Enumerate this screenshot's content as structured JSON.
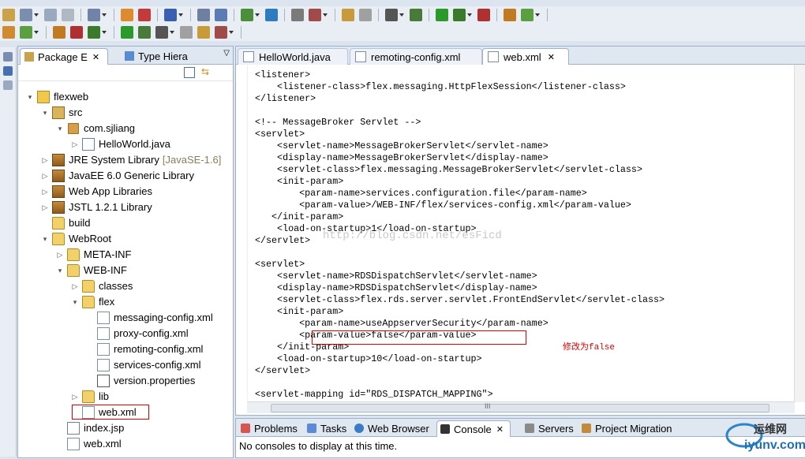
{
  "package_explorer": {
    "tabs": [
      {
        "label": "Package E",
        "close": "✕"
      },
      {
        "label": "Type Hiera"
      }
    ],
    "tree": [
      {
        "label": "flexweb",
        "icon": "project-icon",
        "arrow": "▾"
      },
      {
        "label": "src",
        "icon": "source-folder-icon",
        "arrow": "▾"
      },
      {
        "label": "com.sjliang",
        "icon": "package-icon",
        "arrow": "▾"
      },
      {
        "label": "HelloWorld.java",
        "icon": "java-file-icon",
        "arrow": "▷"
      },
      {
        "label": "JRE System Library",
        "suffix": "[JavaSE-1.6]",
        "icon": "library-icon",
        "arrow": "▷"
      },
      {
        "label": "JavaEE 6.0 Generic Library",
        "icon": "library-icon",
        "arrow": "▷"
      },
      {
        "label": "Web App Libraries",
        "icon": "library-icon",
        "arrow": "▷"
      },
      {
        "label": "JSTL 1.2.1 Library",
        "icon": "library-icon",
        "arrow": "▷"
      },
      {
        "label": "build",
        "icon": "folder-icon",
        "arrow": ""
      },
      {
        "label": "WebRoot",
        "icon": "folder-icon",
        "arrow": "▾"
      },
      {
        "label": "META-INF",
        "icon": "folder-icon",
        "arrow": "▷"
      },
      {
        "label": "WEB-INF",
        "icon": "folder-icon",
        "arrow": "▾"
      },
      {
        "label": "classes",
        "icon": "folder-icon",
        "arrow": "▷"
      },
      {
        "label": "flex",
        "icon": "folder-icon",
        "arrow": "▾"
      },
      {
        "label": "messaging-config.xml",
        "icon": "xml-file-icon",
        "arrow": ""
      },
      {
        "label": "proxy-config.xml",
        "icon": "xml-file-icon",
        "arrow": ""
      },
      {
        "label": "remoting-config.xml",
        "icon": "xml-file-icon",
        "arrow": ""
      },
      {
        "label": "services-config.xml",
        "icon": "xml-file-icon",
        "arrow": ""
      },
      {
        "label": "version.properties",
        "icon": "properties-file-icon",
        "arrow": ""
      },
      {
        "label": "lib",
        "icon": "folder-icon",
        "arrow": "▷"
      },
      {
        "label": "web.xml",
        "icon": "xml-file-icon",
        "arrow": ""
      },
      {
        "label": "index.jsp",
        "icon": "jsp-file-icon",
        "arrow": ""
      },
      {
        "label": "web.xml",
        "icon": "xml-file-icon",
        "arrow": ""
      }
    ]
  },
  "editor": {
    "tabs": [
      {
        "label": "HelloWorld.java"
      },
      {
        "label": "remoting-config.xml"
      },
      {
        "label": "web.xml",
        "close": "✕"
      }
    ],
    "code_lines": [
      "<listener>",
      "    <listener-class>flex.messaging.HttpFlexSession</listener-class>",
      "</listener>",
      "",
      "<!-- MessageBroker Servlet -->",
      "<servlet>",
      "    <servlet-name>MessageBrokerServlet</servlet-name>",
      "    <display-name>MessageBrokerServlet</display-name>",
      "    <servlet-class>flex.messaging.MessageBrokerServlet</servlet-class>",
      "    <init-param>",
      "        <param-name>services.configuration.file</param-name>",
      "        <param-value>/WEB-INF/flex/services-config.xml</param-value>",
      "   </init-param>",
      "    <load-on-startup>1</load-on-startup>",
      "</servlet>",
      "",
      "<servlet>",
      "    <servlet-name>RDSDispatchServlet</servlet-name>",
      "    <display-name>RDSDispatchServlet</display-name>",
      "    <servlet-class>flex.rds.server.servlet.FrontEndServlet</servlet-class>",
      "    <init-param>",
      "        <param-name>useAppserverSecurity</param-name>",
      "        <param-value>false</param-value>",
      "    </init-param>",
      "    <load-on-startup>10</load-on-startup>",
      "</servlet>",
      "",
      "<servlet-mapping id=\"RDS_DISPATCH_MAPPING\">"
    ],
    "annotation": "修改为false",
    "watermark": "http://blog.csdn.net/esFicd",
    "scroll_marker": "III"
  },
  "console": {
    "tabs": [
      {
        "label": "Problems"
      },
      {
        "label": "Tasks"
      },
      {
        "label": "Web Browser"
      },
      {
        "label": "Console",
        "close": "✕"
      },
      {
        "label": "Servers"
      },
      {
        "label": "Project Migration"
      }
    ],
    "message": "No consoles to display at this time."
  },
  "logo": {
    "line1": "运维网",
    "line2": "iyunv.com"
  },
  "colors": {
    "accent": "#9fb0c8",
    "annotation": "#dd0000",
    "tab_bg": "#dfe7f1"
  }
}
